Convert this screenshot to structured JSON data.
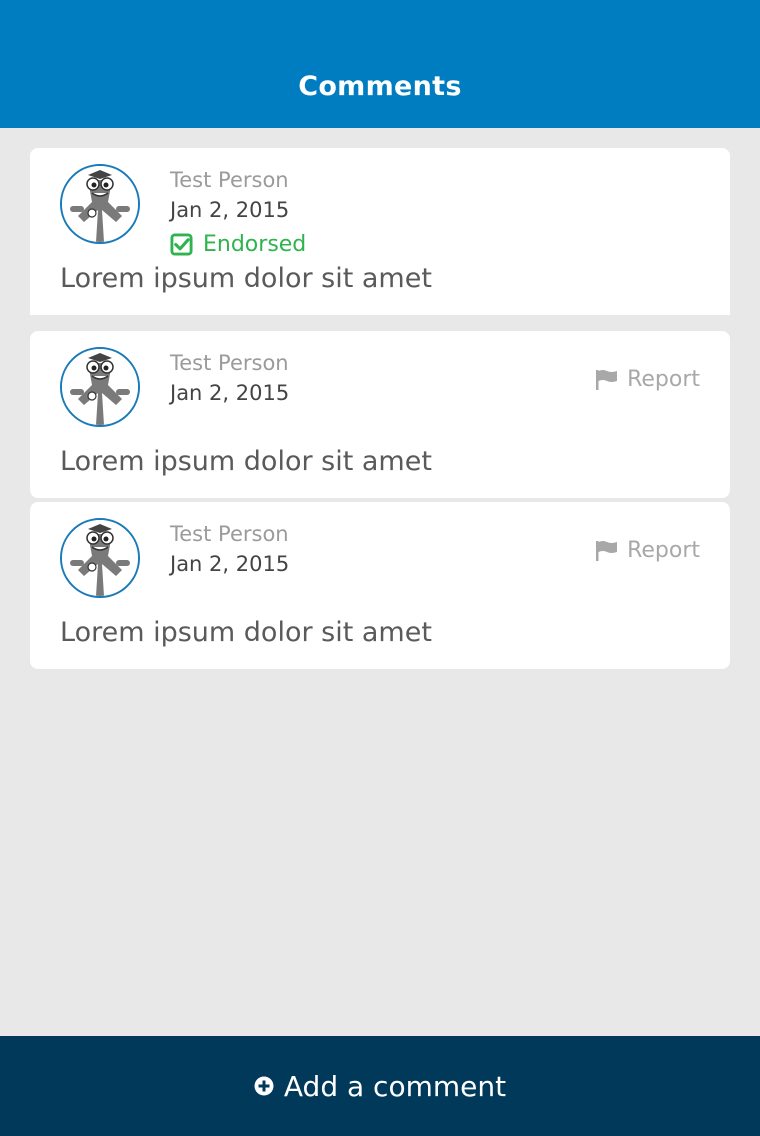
{
  "header": {
    "title": "Comments"
  },
  "comments": [
    {
      "author": "Test Person",
      "date": "Jan 2, 2015",
      "endorsed_label": "Endorsed",
      "text": "Lorem ipsum dolor sit amet"
    },
    {
      "author": "Test Person",
      "date": "Jan 2, 2015",
      "report_label": "Report",
      "text": "Lorem ipsum dolor sit amet"
    },
    {
      "author": "Test Person",
      "date": "Jan 2, 2015",
      "report_label": "Report",
      "text": "Lorem ipsum dolor sit amet"
    }
  ],
  "footer": {
    "add_label": "Add a comment",
    "icon": "plus-circle-icon"
  },
  "colors": {
    "header": "#007dc1",
    "footer": "#00395a",
    "endorsed": "#2fb34f",
    "background": "#e8e8e8"
  }
}
